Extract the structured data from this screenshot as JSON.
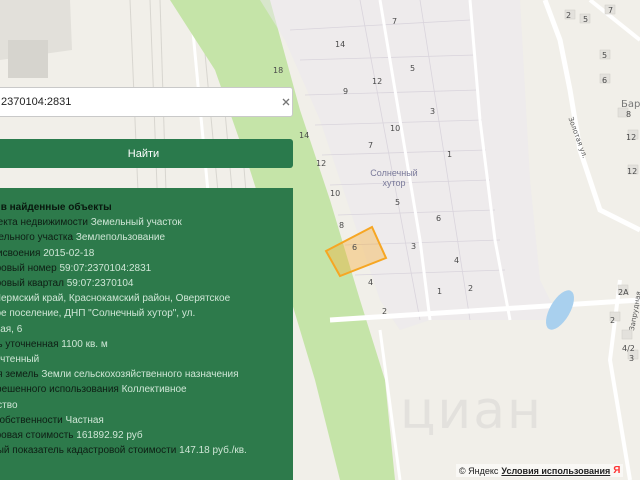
{
  "search": {
    "value": "2370104:2831"
  },
  "find_button": {
    "label": "Найти"
  },
  "map": {
    "labels": [
      "14",
      "7",
      "5",
      "18",
      "9",
      "12",
      "3",
      "14",
      "10",
      "7",
      "1",
      "12",
      "10",
      "5",
      "8",
      "6",
      "3",
      "4",
      "2",
      "4",
      "1",
      "2",
      "2"
    ],
    "place": "Солнечный\nхутор",
    "streets": {
      "zolotaya": "Золотая ул.",
      "zarudnaya": "Запрудная"
    },
    "right_labels": [
      "2",
      "5",
      "6",
      "7",
      "8",
      "12",
      "2A",
      "2",
      "4/2",
      "3",
      "3"
    ],
    "right_place_partial": "Бар"
  },
  "panel": {
    "title": "ад в найденные объекты",
    "rows": [
      {
        "label": "бъекта недвижимости",
        "value": "Земельный участок"
      },
      {
        "label": "емельного участка",
        "value": "Землепользование"
      },
      {
        "label": "присвоения",
        "value": "2015-02-18"
      },
      {
        "label": "стровый номер",
        "value": "59:07:2370104:2831"
      },
      {
        "label": "стровый квартал",
        "value": "59:07:2370104"
      },
      {
        "label": "с",
        "value": "Пермский край, Краснокамский район, Оверятское"
      },
      {
        "label": "",
        "value": "ское поселение, ДНП \"Солнечный хутор\", ул."
      },
      {
        "label": "",
        "value": "говая, 6"
      },
      {
        "label": "адь уточненная",
        "value": "1100 кв. м"
      },
      {
        "label": "с",
        "value": "Учтенный"
      },
      {
        "label": "рия земель",
        "value": "Земли сельскохозяйственного назначения"
      },
      {
        "label": "азрешенного использования",
        "value": "Коллективное"
      },
      {
        "label": "",
        "value": "одство"
      },
      {
        "label": "а собственности",
        "value": "Частная"
      },
      {
        "label": "стровая стоимость",
        "value": "161892.92 руб"
      },
      {
        "label": "ьный показатель кадастровой стоимости",
        "value": "147.18 руб./кв."
      }
    ]
  },
  "footer": {
    "copyright": "© Яндекс",
    "terms": "Условия использования",
    "logo": "Я"
  },
  "colors": {
    "panel_bg": "#2d7a4b",
    "button_bg": "#2a7a4c",
    "highlight_parcel": "#f6a623",
    "forest": "#c5e4a8"
  }
}
